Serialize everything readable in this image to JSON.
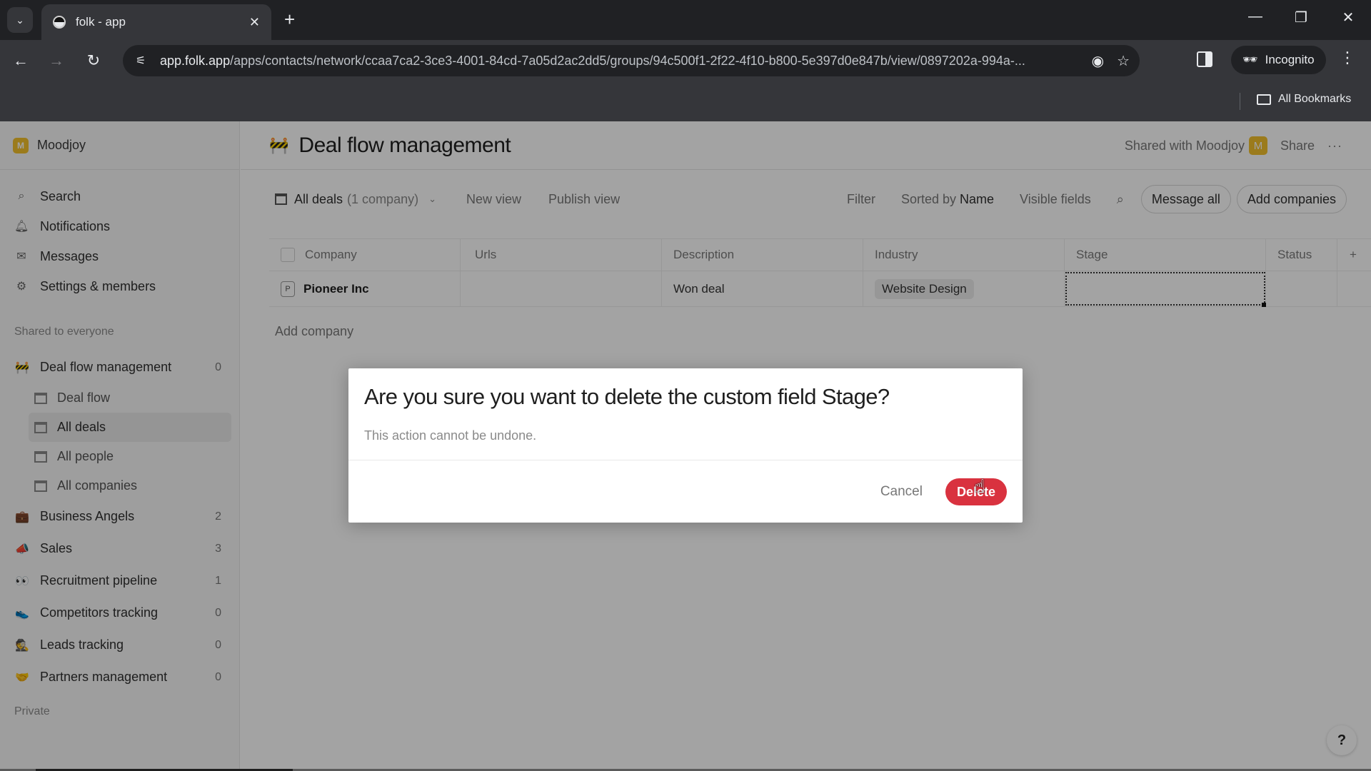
{
  "browser": {
    "tab_title": "folk - app",
    "url_host": "app.folk.app",
    "url_path": "/apps/contacts/network/ccaa7ca2-3ce3-4001-84cd-7a05d2ac2dd5/groups/94c500f1-2f22-4f10-b800-5e397d0e847b/view/0897202a-994a-...",
    "incognito_label": "Incognito",
    "all_bookmarks_label": "All Bookmarks"
  },
  "sidebar": {
    "workspace_initial": "M",
    "workspace_name": "Moodjoy",
    "nav": [
      {
        "icon": "search-icon",
        "label": "Search"
      },
      {
        "icon": "bell-icon",
        "label": "Notifications"
      },
      {
        "icon": "mail-icon",
        "label": "Messages"
      },
      {
        "icon": "gear-icon",
        "label": "Settings & members"
      }
    ],
    "shared_section_label": "Shared to everyone",
    "groups": [
      {
        "emoji": "🚧",
        "label": "Deal flow management",
        "count": "0"
      },
      {
        "emoji": "💼",
        "label": "Business Angels",
        "count": "2"
      },
      {
        "emoji": "📣",
        "label": "Sales",
        "count": "3"
      },
      {
        "emoji": "👀",
        "label": "Recruitment pipeline",
        "count": "1"
      },
      {
        "emoji": "👟",
        "label": "Competitors tracking",
        "count": "0"
      },
      {
        "emoji": "🕵️",
        "label": "Leads tracking",
        "count": "0"
      },
      {
        "emoji": "🤝",
        "label": "Partners management",
        "count": "0"
      }
    ],
    "views": [
      {
        "label": "Deal flow",
        "active": false
      },
      {
        "label": "All deals",
        "active": true
      },
      {
        "label": "All people",
        "active": false
      },
      {
        "label": "All companies",
        "active": false
      }
    ],
    "private_section_label": "Private"
  },
  "header": {
    "emoji": "🚧",
    "title": "Deal flow management",
    "shared_with": "Shared with Moodjoy",
    "shared_badge": "M",
    "share_label": "Share",
    "more_label": "···"
  },
  "toolbar": {
    "view_name": "All deals",
    "view_count": "(1 company)",
    "new_view": "New view",
    "publish_view": "Publish view",
    "filter": "Filter",
    "sorted_by_prefix": "Sorted by",
    "sorted_by_field": "Name",
    "visible_fields": "Visible fields",
    "message_all": "Message all",
    "add_companies": "Add companies"
  },
  "table": {
    "columns": [
      "Company",
      "Urls",
      "Description",
      "Industry",
      "Stage",
      "Status",
      "+"
    ],
    "rows": [
      {
        "avatar": "P",
        "company": "Pioneer Inc",
        "urls": "",
        "description": "Won deal",
        "industry": "Website Design",
        "stage": "",
        "status": ""
      }
    ],
    "add_row_label": "Add company"
  },
  "dialog": {
    "title": "Are you sure you want to delete the custom field Stage?",
    "description": "This action cannot be undone.",
    "cancel_label": "Cancel",
    "delete_label": "Delete"
  },
  "help_label": "?",
  "colors": {
    "accent_delete": "#d9323f",
    "workspace_badge": "#f2c02d"
  }
}
